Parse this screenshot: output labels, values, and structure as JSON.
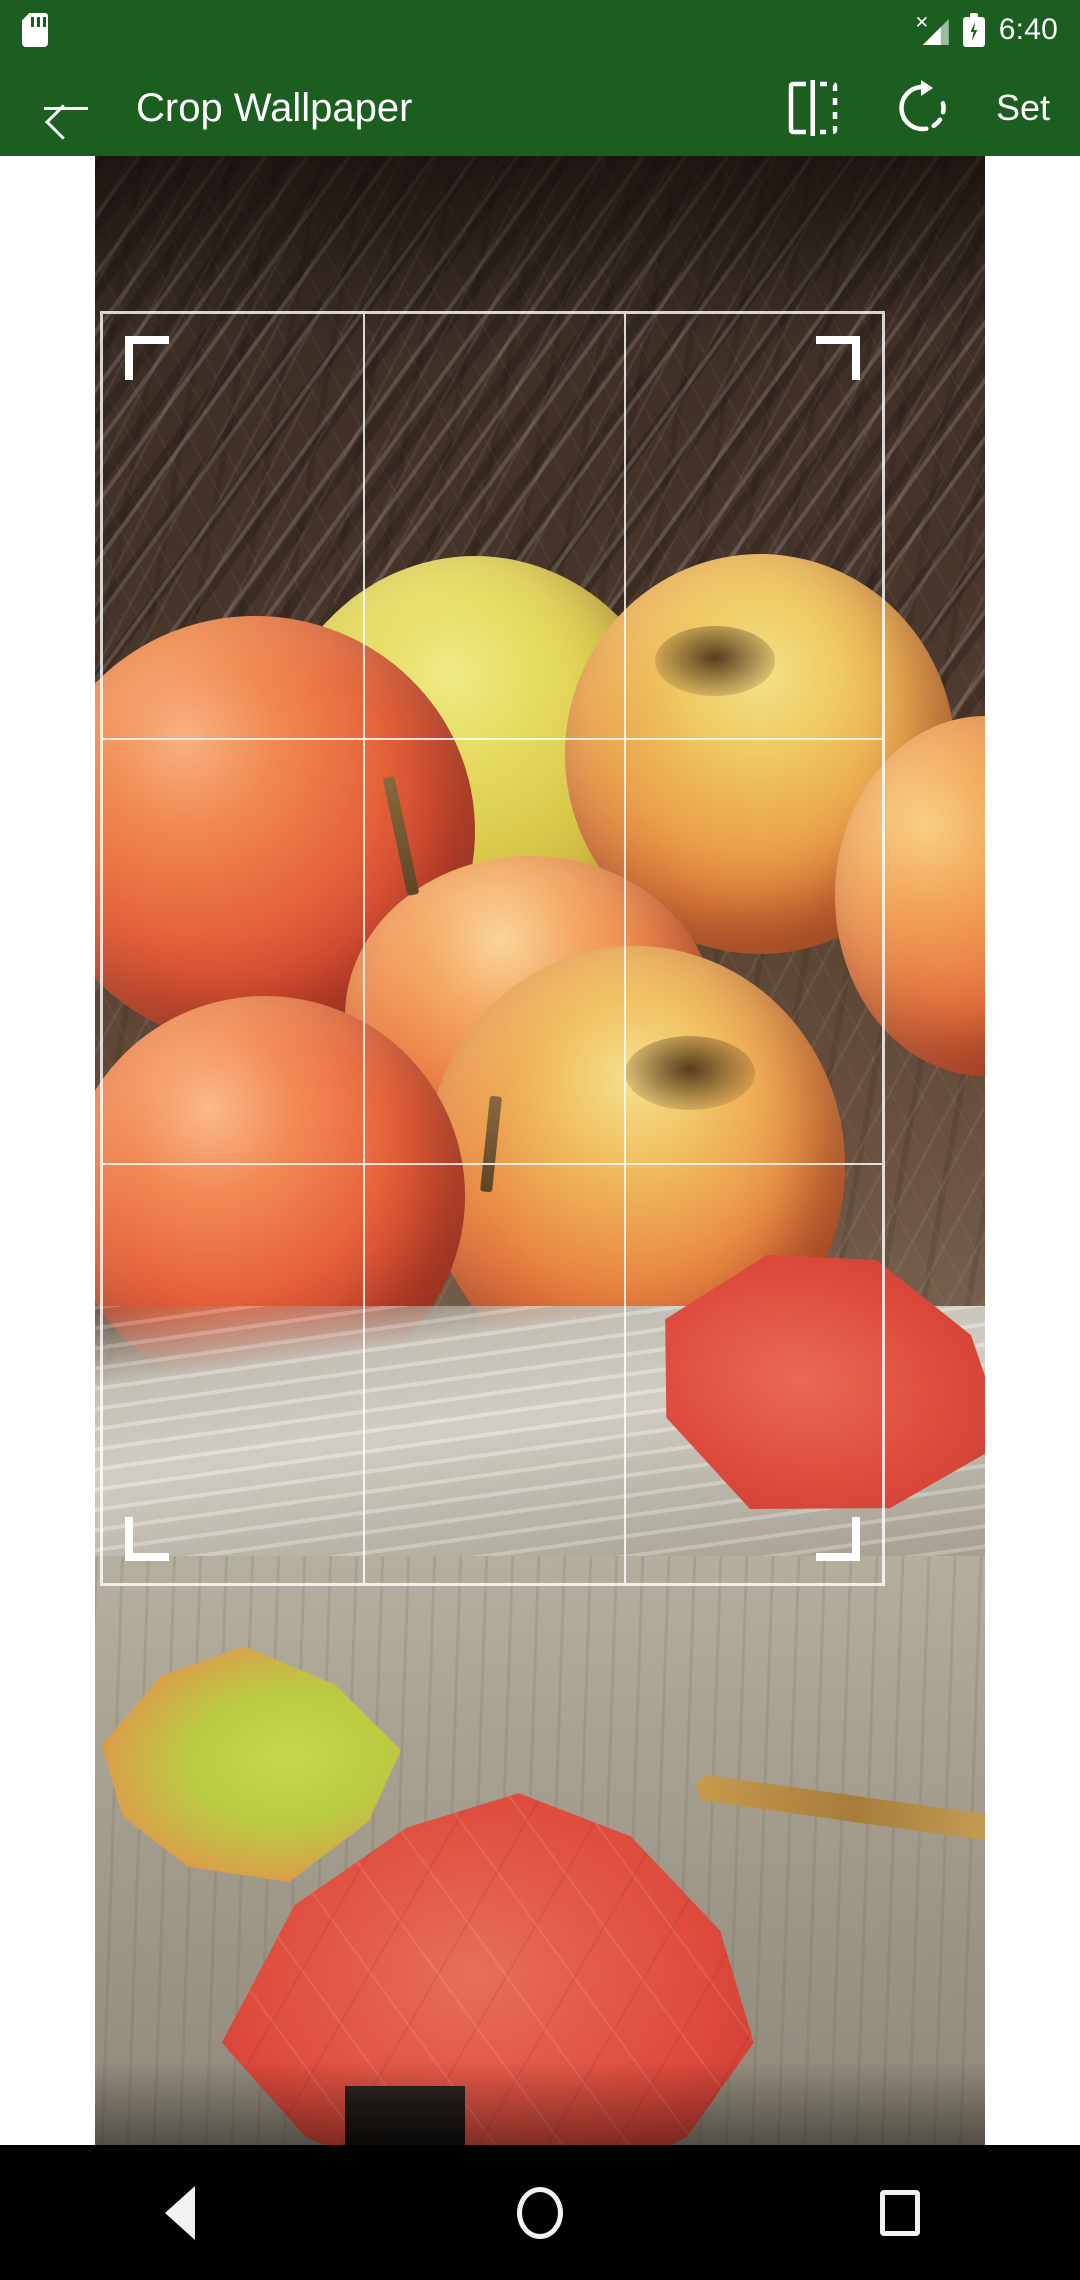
{
  "status_bar": {
    "sd_card_icon": "sd-card-icon",
    "signal_icon": "signal-no-sim-icon",
    "battery_icon": "battery-charging-icon",
    "time": "6:40"
  },
  "app_bar": {
    "back_icon": "back-arrow-icon",
    "title": "Crop Wallpaper",
    "flip_icon": "flip-horizontal-icon",
    "rotate_icon": "rotate-right-icon",
    "set_label": "Set",
    "accent_color": "#1c5e1f"
  },
  "crop": {
    "grid": "rule-of-thirds",
    "grid_columns": 3,
    "grid_rows": 3,
    "frame_color": "#ffffff",
    "handle_corners": [
      "top-left",
      "top-right",
      "bottom-left",
      "bottom-right"
    ],
    "photo_subject": "apples and autumn leaves in a wicker basket"
  },
  "nav_bar": {
    "back_icon": "nav-back-triangle-icon",
    "home_icon": "nav-home-circle-icon",
    "recents_icon": "nav-recents-square-icon",
    "background_color": "#000000"
  }
}
